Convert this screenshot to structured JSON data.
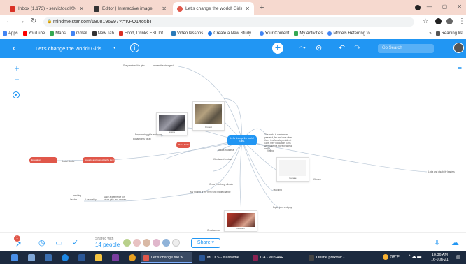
{
  "browser": {
    "tabs": [
      {
        "label": "Inbox (1,173) - servicfocol@gm...",
        "icon_color": "#d93025",
        "icon": "gmail-icon"
      },
      {
        "label": "Editor | Interactive image",
        "icon_color": "#333333",
        "icon": "genially-icon"
      },
      {
        "label": "Let's change the world! Girls - Mi",
        "icon_color": "#e0574a",
        "icon": "mindmeister-icon"
      }
    ],
    "new_tab": "+",
    "url": "mindmeister.com/1808196997?t=KFO14o5bT",
    "bookmarks": [
      {
        "label": "Apps",
        "color": "#4285f4"
      },
      {
        "label": "YouTube",
        "color": "#ff0000"
      },
      {
        "label": "Maps",
        "color": "#34a853"
      },
      {
        "label": "Gmail",
        "color": "#4285f4"
      },
      {
        "label": "New Tab",
        "color": "#333333"
      },
      {
        "label": "Food, Drinks ESL Int...",
        "color": "#d93025"
      },
      {
        "label": "Video lessons",
        "color": "#2b7bb9"
      },
      {
        "label": "Create a New Study...",
        "color": "#1a73e8"
      },
      {
        "label": "Your Content",
        "color": "#4285f4"
      },
      {
        "label": "My Activities",
        "color": "#34a853"
      },
      {
        "label": "Models Referring to...",
        "color": "#4285f4"
      }
    ],
    "reading_list": "Reading list",
    "more_bookmarks": "»"
  },
  "toolbar": {
    "back": "‹",
    "title": "Let's change the world! Girls.",
    "caret": "▾",
    "info": "i",
    "add": "+",
    "search_placeholder": "Go Search"
  },
  "mindmap": {
    "root": "Let's change the world! Girls.",
    "right_note": "The world is made more peaceful, fair and safe when there is a female president. Girls, their education, Girls will make it a more peaceful world.",
    "far_right": "Leda and disability leaders",
    "top_left_a": "She persisted for girls",
    "top_left_b": "women the strongest",
    "mid_left_a": "Empowering girls and boys",
    "mid_left_b": "Equal rights for all",
    "pill_a": "Education",
    "pill_b": "Equality and respect is the key for all girls",
    "pill_c": "My mother is my hero who made change",
    "mid_label": "Rosa Parks",
    "center_a": "Malala Yousafzai",
    "center_b": "Words and protest",
    "center_c": "Social Media",
    "lower_a": "Greta Thunberg, climate",
    "left_small_a": "Inspiring",
    "left_small_b": "Leader",
    "left_small_c": "Make a difference for future girls and women",
    "right_a": "Voting",
    "right_b": "Women",
    "right_c": "Teaching",
    "right_d": "Equal jobs and pay",
    "right_e": "Leadership",
    "bottom_label": "Great women",
    "img_caption_1": "Emma",
    "img_caption_2": "Protest",
    "img_caption_3": "Female",
    "img_caption_4": "Activism"
  },
  "bottom": {
    "notif_count": "1",
    "shared_label": "Shared with",
    "shared_count": "14 people",
    "share_button": "Share ▾"
  },
  "taskbar": {
    "tasks": [
      {
        "label": "Let's change the w...",
        "color": "#e0574a"
      },
      {
        "label": "MO KS - Nastavne ...",
        "color": "#2b5797"
      },
      {
        "label": "CA - WinRAR",
        "color": "#8b2252"
      },
      {
        "label": "Online prekvalr - ...",
        "color": "#444444"
      }
    ],
    "weather": "58°F",
    "time": "10:36 AM",
    "date": "16-Jun-21"
  }
}
